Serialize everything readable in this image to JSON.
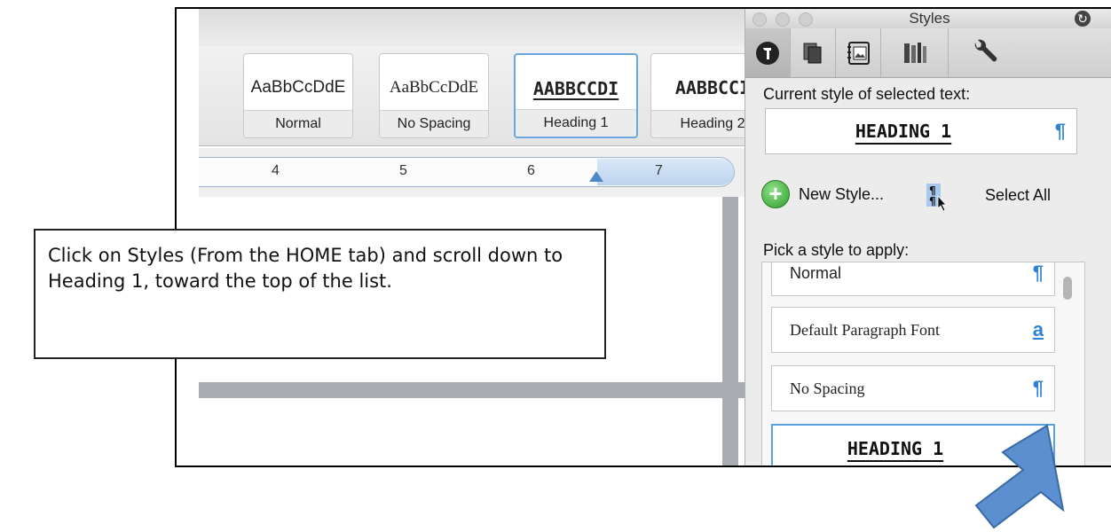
{
  "ribbon": {
    "style_gallery": [
      {
        "sample": "AaBbCcDdE",
        "label": "Normal"
      },
      {
        "sample": "AaBbCcDdE",
        "label": "No Spacing"
      },
      {
        "sample": "AABBCCDI",
        "label": "Heading 1",
        "selected": true
      },
      {
        "sample": "AABBCCI",
        "label": "Heading 2"
      }
    ]
  },
  "ruler": {
    "numbers": [
      "4",
      "5",
      "6",
      "7"
    ]
  },
  "styles_palette": {
    "title": "Styles",
    "toolbar_icons": [
      "styles-icon",
      "copy-icon",
      "media-browser-icon",
      "reference-tools-icon",
      "wrench-icon"
    ],
    "current_style_label": "Current style of selected text:",
    "current_style_value": "HEADING 1",
    "new_style_label": "New Style...",
    "select_all_label": "Select All",
    "pick_label": "Pick a style to apply:",
    "list_items": [
      {
        "label": "Normal",
        "icon": "¶"
      },
      {
        "label": "Default Paragraph Font",
        "icon": "a"
      },
      {
        "label": "No Spacing",
        "icon": "¶"
      },
      {
        "label": "HEADING 1",
        "icon": "¶",
        "selected": true
      }
    ],
    "pilcrow": "¶"
  },
  "callout": {
    "text": "Click on Styles (From the HOME tab) and scroll down to Heading 1, toward the top of the list."
  },
  "colors": {
    "accent_blue": "#2e82d6",
    "selection_border": "#5aa0e4",
    "arrow_fill": "#5b8fd0",
    "plus_green": "#2f9e2b"
  }
}
